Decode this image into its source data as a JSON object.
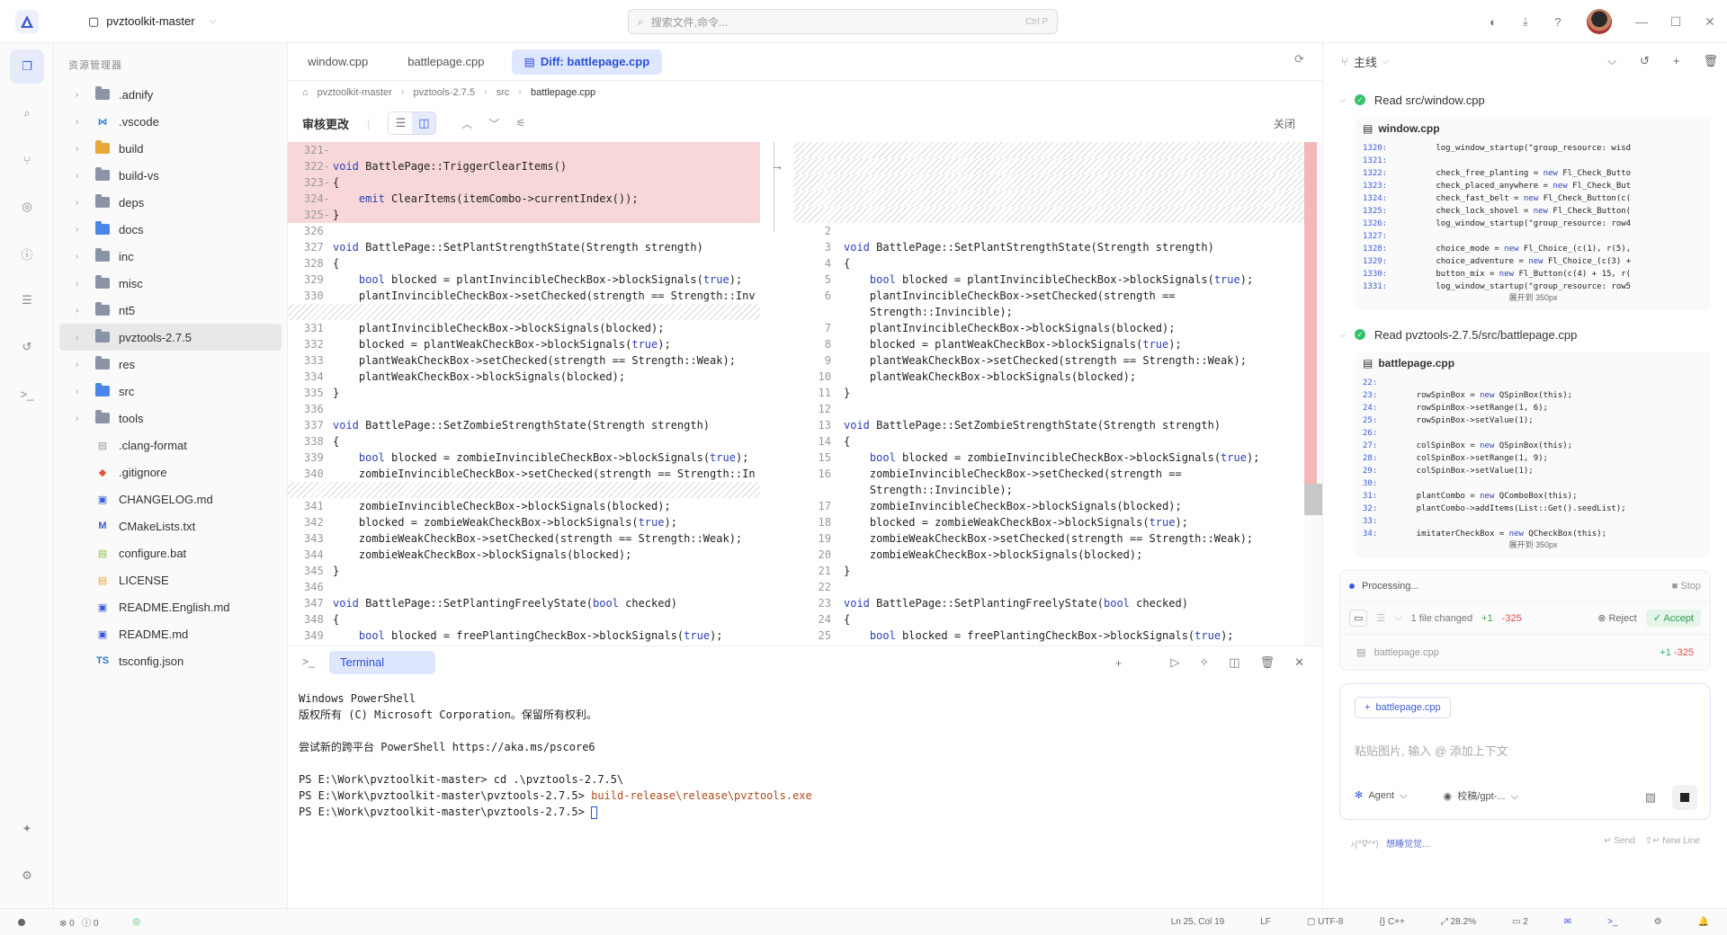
{
  "titlebar": {
    "project": "pvztoolkit-master",
    "search_placeholder": "搜索文件,命令...",
    "search_shortcut": "Ctrl P"
  },
  "explorer": {
    "title": "资源管理器",
    "items": [
      {
        "name": ".adnify",
        "type": "folder",
        "color": "gray"
      },
      {
        "name": ".vscode",
        "type": "vscode"
      },
      {
        "name": "build",
        "type": "folder",
        "color": "orange"
      },
      {
        "name": "build-vs",
        "type": "folder",
        "color": "gray"
      },
      {
        "name": "deps",
        "type": "folder",
        "color": "gray"
      },
      {
        "name": "docs",
        "type": "folder",
        "color": "blue"
      },
      {
        "name": "inc",
        "type": "folder",
        "color": "gray"
      },
      {
        "name": "misc",
        "type": "folder",
        "color": "gray"
      },
      {
        "name": "nt5",
        "type": "folder",
        "color": "gray"
      },
      {
        "name": "pvztools-2.7.5",
        "type": "folder",
        "color": "gray"
      },
      {
        "name": "res",
        "type": "folder",
        "color": "gray"
      },
      {
        "name": "src",
        "type": "folder",
        "color": "blue"
      },
      {
        "name": "tools",
        "type": "folder",
        "color": "gray"
      },
      {
        "name": ".clang-format",
        "type": "file"
      },
      {
        "name": ".gitignore",
        "type": "git"
      },
      {
        "name": "CHANGELOG.md",
        "type": "md"
      },
      {
        "name": "CMakeLists.txt",
        "type": "cmake"
      },
      {
        "name": "configure.bat",
        "type": "bat"
      },
      {
        "name": "LICENSE",
        "type": "license"
      },
      {
        "name": "README.English.md",
        "type": "md"
      },
      {
        "name": "README.md",
        "type": "md"
      },
      {
        "name": "tsconfig.json",
        "type": "ts"
      }
    ]
  },
  "tabs": [
    "window.cpp",
    "battlepage.cpp",
    "Diff: battlepage.cpp"
  ],
  "breadcrumb": [
    "pvztoolkit-master",
    "pvztools-2.7.5",
    "src",
    "battlepage.cpp"
  ],
  "review": {
    "label": "审核更改",
    "close": "关闭"
  },
  "diff_left": [
    {
      "n": "321",
      "mark": "-",
      "code": "",
      "t": "del"
    },
    {
      "n": "322",
      "mark": "-",
      "code": "void BattlePage::TriggerClearItems()",
      "t": "del"
    },
    {
      "n": "323",
      "mark": "-",
      "code": "{",
      "t": "del"
    },
    {
      "n": "324",
      "mark": "-",
      "code": "    emit ClearItems(itemCombo->currentIndex());",
      "t": "del"
    },
    {
      "n": "325",
      "mark": "-",
      "code": "}",
      "t": "del"
    },
    {
      "n": "326",
      "mark": "",
      "code": "",
      "t": ""
    },
    {
      "n": "327",
      "mark": "",
      "code": "void BattlePage::SetPlantStrengthState(Strength strength)",
      "t": ""
    },
    {
      "n": "328",
      "mark": "",
      "code": "{",
      "t": ""
    },
    {
      "n": "329",
      "mark": "",
      "code": "    bool blocked = plantInvincibleCheckBox->blockSignals(true);",
      "t": ""
    },
    {
      "n": "330",
      "mark": "",
      "code": "    plantInvincibleCheckBox->setChecked(strength == Strength::Inv",
      "t": ""
    },
    {
      "n": "",
      "mark": "",
      "code": "",
      "t": "hatch"
    },
    {
      "n": "331",
      "mark": "",
      "code": "    plantInvincibleCheckBox->blockSignals(blocked);",
      "t": ""
    },
    {
      "n": "332",
      "mark": "",
      "code": "    blocked = plantWeakCheckBox->blockSignals(true);",
      "t": ""
    },
    {
      "n": "333",
      "mark": "",
      "code": "    plantWeakCheckBox->setChecked(strength == Strength::Weak);",
      "t": ""
    },
    {
      "n": "334",
      "mark": "",
      "code": "    plantWeakCheckBox->blockSignals(blocked);",
      "t": ""
    },
    {
      "n": "335",
      "mark": "",
      "code": "}",
      "t": ""
    },
    {
      "n": "336",
      "mark": "",
      "code": "",
      "t": ""
    },
    {
      "n": "337",
      "mark": "",
      "code": "void BattlePage::SetZombieStrengthState(Strength strength)",
      "t": ""
    },
    {
      "n": "338",
      "mark": "",
      "code": "{",
      "t": ""
    },
    {
      "n": "339",
      "mark": "",
      "code": "    bool blocked = zombieInvincibleCheckBox->blockSignals(true);",
      "t": ""
    },
    {
      "n": "340",
      "mark": "",
      "code": "    zombieInvincibleCheckBox->setChecked(strength == Strength::In",
      "t": ""
    },
    {
      "n": "",
      "mark": "",
      "code": "",
      "t": "hatch"
    },
    {
      "n": "341",
      "mark": "",
      "code": "    zombieInvincibleCheckBox->blockSignals(blocked);",
      "t": ""
    },
    {
      "n": "342",
      "mark": "",
      "code": "    blocked = zombieWeakCheckBox->blockSignals(true);",
      "t": ""
    },
    {
      "n": "343",
      "mark": "",
      "code": "    zombieWeakCheckBox->setChecked(strength == Strength::Weak);",
      "t": ""
    },
    {
      "n": "344",
      "mark": "",
      "code": "    zombieWeakCheckBox->blockSignals(blocked);",
      "t": ""
    },
    {
      "n": "345",
      "mark": "",
      "code": "}",
      "t": ""
    },
    {
      "n": "346",
      "mark": "",
      "code": "",
      "t": ""
    },
    {
      "n": "347",
      "mark": "",
      "code": "void BattlePage::SetPlantingFreelyState(bool checked)",
      "t": ""
    },
    {
      "n": "348",
      "mark": "",
      "code": "{",
      "t": ""
    },
    {
      "n": "349",
      "mark": "",
      "code": "    bool blocked = freePlantingCheckBox->blockSignals(true);",
      "t": ""
    }
  ],
  "diff_right": [
    {
      "n": "",
      "code": "",
      "t": "hatch"
    },
    {
      "n": "",
      "code": "",
      "t": "hatch"
    },
    {
      "n": "",
      "code": "",
      "t": "hatch"
    },
    {
      "n": "",
      "code": "",
      "t": "hatch"
    },
    {
      "n": "",
      "code": "",
      "t": "hatch"
    },
    {
      "n": "2",
      "code": "",
      "t": ""
    },
    {
      "n": "3",
      "code": "void BattlePage::SetPlantStrengthState(Strength strength)",
      "t": ""
    },
    {
      "n": "4",
      "code": "{",
      "t": ""
    },
    {
      "n": "5",
      "code": "    bool blocked = plantInvincibleCheckBox->blockSignals(true);",
      "t": ""
    },
    {
      "n": "6",
      "code": "    plantInvincibleCheckBox->setChecked(strength ==",
      "t": ""
    },
    {
      "n": "",
      "code": "    Strength::Invincible);",
      "t": ""
    },
    {
      "n": "7",
      "code": "    plantInvincibleCheckBox->blockSignals(blocked);",
      "t": ""
    },
    {
      "n": "8",
      "code": "    blocked = plantWeakCheckBox->blockSignals(true);",
      "t": ""
    },
    {
      "n": "9",
      "code": "    plantWeakCheckBox->setChecked(strength == Strength::Weak);",
      "t": ""
    },
    {
      "n": "10",
      "code": "    plantWeakCheckBox->blockSignals(blocked);",
      "t": ""
    },
    {
      "n": "11",
      "code": "}",
      "t": ""
    },
    {
      "n": "12",
      "code": "",
      "t": ""
    },
    {
      "n": "13",
      "code": "void BattlePage::SetZombieStrengthState(Strength strength)",
      "t": ""
    },
    {
      "n": "14",
      "code": "{",
      "t": ""
    },
    {
      "n": "15",
      "code": "    bool blocked = zombieInvincibleCheckBox->blockSignals(true);",
      "t": ""
    },
    {
      "n": "16",
      "code": "    zombieInvincibleCheckBox->setChecked(strength ==",
      "t": ""
    },
    {
      "n": "",
      "code": "    Strength::Invincible);",
      "t": ""
    },
    {
      "n": "17",
      "code": "    zombieInvincibleCheckBox->blockSignals(blocked);",
      "t": ""
    },
    {
      "n": "18",
      "code": "    blocked = zombieWeakCheckBox->blockSignals(true);",
      "t": ""
    },
    {
      "n": "19",
      "code": "    zombieWeakCheckBox->setChecked(strength == Strength::Weak);",
      "t": ""
    },
    {
      "n": "20",
      "code": "    zombieWeakCheckBox->blockSignals(blocked);",
      "t": ""
    },
    {
      "n": "21",
      "code": "}",
      "t": ""
    },
    {
      "n": "22",
      "code": "",
      "t": ""
    },
    {
      "n": "23",
      "code": "void BattlePage::SetPlantingFreelyState(bool checked)",
      "t": ""
    },
    {
      "n": "24",
      "code": "{",
      "t": ""
    },
    {
      "n": "25",
      "code": "    bool blocked = freePlantingCheckBox->blockSignals(true);",
      "t": ""
    }
  ],
  "terminal": {
    "tab": "Terminal",
    "lines": [
      "Windows PowerShell",
      "版权所有 (C) Microsoft Corporation。保留所有权利。",
      "",
      "尝试新的跨平台 PowerShell https://aka.ms/pscore6",
      ""
    ],
    "prompt1": "PS E:\\Work\\pvztoolkit-master> ",
    "cmd1": "cd .\\pvztools-2.7.5\\",
    "prompt2": "PS E:\\Work\\pvztoolkit-master\\pvztools-2.7.5> ",
    "cmd2": "build-release\\release\\pvztools.exe",
    "prompt3": "PS E:\\Work\\pvztoolkit-master\\pvztools-2.7.5> "
  },
  "agent": {
    "branch": "主线",
    "tool1": {
      "title": "Read src/window.cpp",
      "file": "window.cpp",
      "lines": [
        {
          "n": "1320:",
          "c": "        log_window_startup(\"group_resource: wisd"
        },
        {
          "n": "1321:",
          "c": ""
        },
        {
          "n": "1322:",
          "c": "        check_free_planting = new Fl_Check_Butto"
        },
        {
          "n": "1323:",
          "c": "        check_placed_anywhere = new Fl_Check_But"
        },
        {
          "n": "1324:",
          "c": "        check_fast_belt = new Fl_Check_Button(c("
        },
        {
          "n": "1325:",
          "c": "        check_lock_shovel = new Fl_Check_Button("
        },
        {
          "n": "1326:",
          "c": "        log_window_startup(\"group_resource: row4"
        },
        {
          "n": "1327:",
          "c": ""
        },
        {
          "n": "1328:",
          "c": "        choice_mode = new Fl_Choice_(c(1), r(5),"
        },
        {
          "n": "1329:",
          "c": "        choice_adventure = new Fl_Choice_(c(3) +"
        },
        {
          "n": "1330:",
          "c": "        button_mix = new Fl_Button(c(4) + 15, r("
        },
        {
          "n": "1331:",
          "c": "        log_window_startup(\"group_resource: row5"
        }
      ],
      "expand": "展开到 350px"
    },
    "tool2": {
      "title": "Read pvztools-2.7.5/src/battlepage.cpp",
      "file": "battlepage.cpp",
      "lines": [
        {
          "n": "22:",
          "c": ""
        },
        {
          "n": "23:",
          "c": "    rowSpinBox = new QSpinBox(this);"
        },
        {
          "n": "24:",
          "c": "    rowSpinBox->setRange(1, 6);"
        },
        {
          "n": "25:",
          "c": "    rowSpinBox->setValue(1);"
        },
        {
          "n": "26:",
          "c": ""
        },
        {
          "n": "27:",
          "c": "    colSpinBox = new QSpinBox(this);"
        },
        {
          "n": "28:",
          "c": "    colSpinBox->setRange(1, 9);"
        },
        {
          "n": "29:",
          "c": "    colSpinBox->setValue(1);"
        },
        {
          "n": "30:",
          "c": ""
        },
        {
          "n": "31:",
          "c": "    plantCombo = new QComboBox(this);"
        },
        {
          "n": "32:",
          "c": "    plantCombo->addItems(List::Get().seedList);"
        },
        {
          "n": "33:",
          "c": ""
        },
        {
          "n": "34:",
          "c": "    imitaterCheckBox = new QCheckBox(this);"
        }
      ],
      "expand": "展开到 350px"
    },
    "processing": "Processing...",
    "stop": "Stop",
    "files_changed": "1 file changed",
    "plus": "+1",
    "minus": "-325",
    "reject": "Reject",
    "accept": "Accept",
    "changed_file": "battlepage.cpp",
    "chip": "battlepage.cpp",
    "input_placeholder": "粘贴图片, 输入 @ 添加上下文",
    "mode": "Agent",
    "model": "校稿/gpt-...",
    "hint_kaomoji": "♪(^∇^*)",
    "hint_text": "想睡觉觉...",
    "send_hint": "Send",
    "newline_hint": "New Line"
  },
  "status": {
    "errors": "0",
    "warnings": "0",
    "position": "Ln 25, Col 19",
    "eol": "LF",
    "encoding": "UTF-8",
    "lang": "C++",
    "zoom": "28.2%",
    "comments": "2"
  },
  "colors": {
    "accent": "#3b5bdb",
    "deleted": "#f7d7d7",
    "accept": "#2e9c57"
  }
}
